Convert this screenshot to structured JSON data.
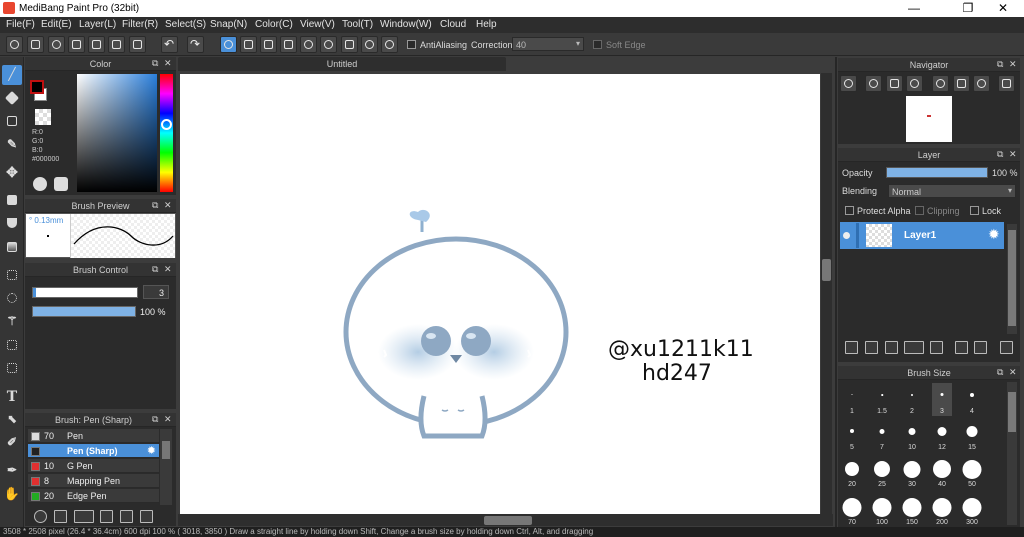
{
  "window": {
    "title": "MediBang Paint Pro (32bit)",
    "minimize": "—",
    "maximize": "❐",
    "close": "✕"
  },
  "menu": [
    "File(F)",
    "Edit(E)",
    "Layer(L)",
    "Filter(R)",
    "Select(S)",
    "Snap(N)",
    "Color(C)",
    "View(V)",
    "Tool(T)",
    "Window(W)",
    "Cloud",
    "Help"
  ],
  "toolbar": {
    "antialiasing": "AntiAliasing",
    "correction_label": "Correction",
    "correction_value": "40",
    "soft_edge": "Soft Edge"
  },
  "color_panel": {
    "title": "Color",
    "r": "R:0",
    "g": "G:0",
    "b": "B:0",
    "hex": "#000000",
    "foreground": "#000000",
    "background": "#ffffff"
  },
  "brush_preview": {
    "title": "Brush Preview",
    "size": "0.13mm"
  },
  "brush_control": {
    "title": "Brush Control",
    "size_value": "3",
    "opacity_value": "100 %",
    "opacity_percent": 100
  },
  "brush_list": {
    "title": "Brush: Pen (Sharp)",
    "items": [
      {
        "size": "70",
        "name": "Pen",
        "color": "#dddddd"
      },
      {
        "size": "3",
        "name": "Pen (Sharp)",
        "color": "#222222"
      },
      {
        "size": "10",
        "name": "G Pen",
        "color": "#e03030"
      },
      {
        "size": "8",
        "name": "Mapping Pen",
        "color": "#e03030"
      },
      {
        "size": "20",
        "name": "Edge Pen",
        "color": "#22aa22"
      }
    ]
  },
  "canvas": {
    "tab_title": "Untitled",
    "watermark_line1": "@xu1211k11",
    "watermark_line2": "hd247"
  },
  "navigator": {
    "title": "Navigator"
  },
  "layer_panel": {
    "title": "Layer",
    "opacity_label": "Opacity",
    "opacity_value": "100 %",
    "opacity_percent": 100,
    "blending_label": "Blending",
    "blending_value": "Normal",
    "protect_alpha": "Protect Alpha",
    "clipping": "Clipping",
    "lock": "Lock",
    "layer_name": "Layer1"
  },
  "brush_size": {
    "title": "Brush Size",
    "sizes": [
      "1",
      "1.5",
      "2",
      "3",
      "4",
      "5",
      "7",
      "10",
      "12",
      "15",
      "20",
      "25",
      "30",
      "40",
      "50",
      "70",
      "100",
      "150",
      "200",
      "300"
    ]
  },
  "status": {
    "text": "3508 * 2508 pixel   (26.4 * 36.4cm)   600 dpi   100 %   ( 3018, 3850 )   Draw a straight line by holding down Shift, Change a brush size by holding down Ctrl, Alt, and dragging"
  }
}
